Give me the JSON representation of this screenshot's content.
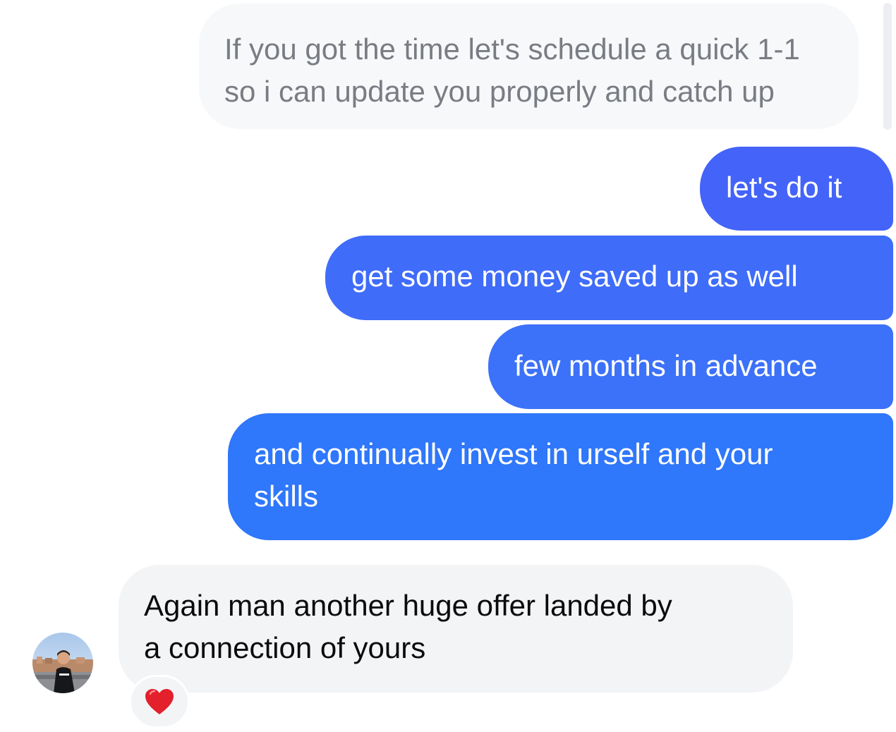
{
  "conversation": {
    "messages": [
      {
        "direction": "incoming",
        "lines": [
          "If you got the time let's schedule a quick 1-1",
          "so i can update you properly and catch up"
        ]
      },
      {
        "direction": "outgoing",
        "lines": [
          "let's do it"
        ]
      },
      {
        "direction": "outgoing",
        "lines": [
          "get some money saved up as well"
        ]
      },
      {
        "direction": "outgoing",
        "lines": [
          "few months in advance"
        ]
      },
      {
        "direction": "outgoing",
        "lines": [
          "and continually invest in urself and your",
          "skills"
        ]
      },
      {
        "direction": "incoming",
        "lines": [
          "Again man another huge offer landed by",
          "a connection of yours"
        ],
        "reaction": "❤️"
      }
    ]
  },
  "colors": {
    "outgoing_bubble_top": "#4463f8",
    "outgoing_bubble_bottom": "#2f77fb",
    "incoming_bubble": "#f3f4f6",
    "reaction_heart": "#e3202b"
  }
}
